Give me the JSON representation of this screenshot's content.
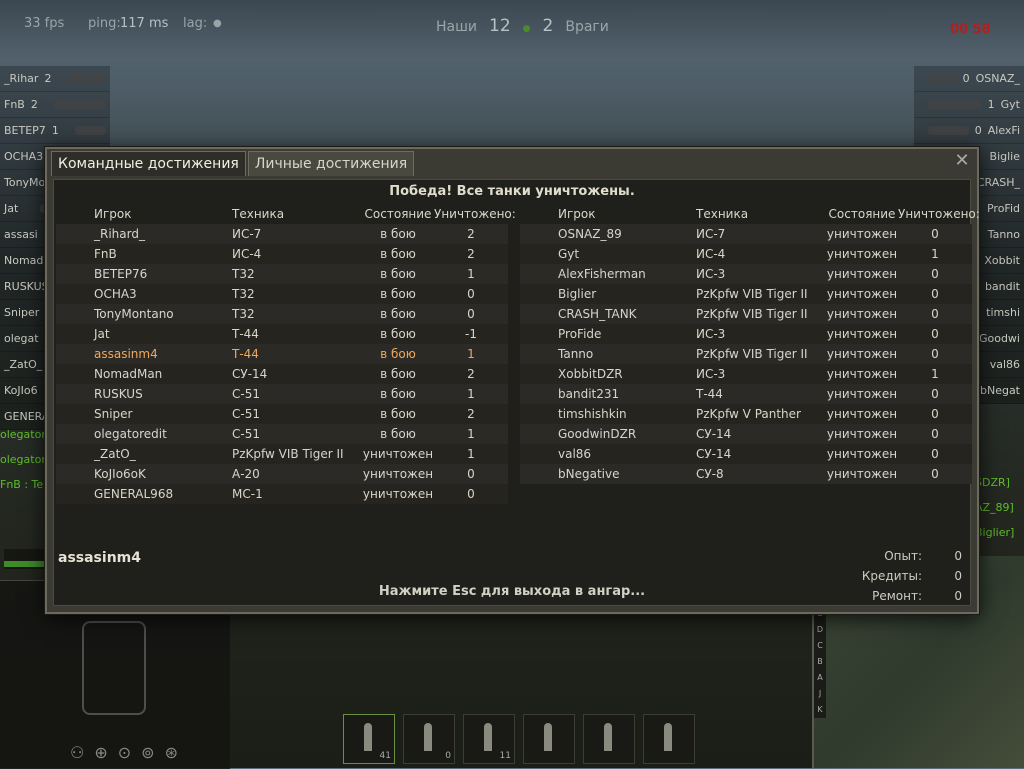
{
  "hud": {
    "fps": "33 fps",
    "ping_label": "ping:",
    "ping_value": "117 ms",
    "lag_label": "lag:",
    "allies_label": "Наши",
    "enemies_label": "Враги",
    "allies_score": "12",
    "enemies_score": "2",
    "timer": "00 58"
  },
  "side_left": [
    {
      "name": "_Rihar",
      "kills": "2"
    },
    {
      "name": "FnB",
      "kills": "2"
    },
    {
      "name": "BETEP7",
      "kills": "1"
    },
    {
      "name": "OCHA3",
      "kills": ""
    },
    {
      "name": "TonyMo",
      "kills": ""
    },
    {
      "name": "Jat",
      "kills": ""
    },
    {
      "name": "assasi",
      "kills": ""
    },
    {
      "name": "NomadM",
      "kills": ""
    },
    {
      "name": "RUSKUS",
      "kills": ""
    },
    {
      "name": "Sniper",
      "kills": ""
    },
    {
      "name": "olegat",
      "kills": ""
    },
    {
      "name": "_ZatO_",
      "kills": ""
    },
    {
      "name": "KoJIo6",
      "kills": ""
    },
    {
      "name": "GENERA",
      "kills": ""
    }
  ],
  "side_right": [
    {
      "name": "OSNAZ_",
      "kills": "0"
    },
    {
      "name": "Gyt",
      "kills": "1"
    },
    {
      "name": "AlexFi",
      "kills": "0"
    },
    {
      "name": "Biglie",
      "kills": ""
    },
    {
      "name": "CRASH_",
      "kills": ""
    },
    {
      "name": "ProFid",
      "kills": ""
    },
    {
      "name": "Tanno",
      "kills": ""
    },
    {
      "name": "Xobbit",
      "kills": ""
    },
    {
      "name": "bandit",
      "kills": ""
    },
    {
      "name": "timshi",
      "kills": ""
    },
    {
      "name": "Goodwi",
      "kills": ""
    },
    {
      "name": "val86",
      "kills": ""
    },
    {
      "name": "bNegat",
      "kills": ""
    }
  ],
  "chat": [
    "olegator",
    "olegator",
    "FnB : Te"
  ],
  "chat_right": [
    "SDZR]",
    "AZ_89]",
    "Biglier]"
  ],
  "minimap_letters": [
    "E",
    "D",
    "C",
    "B",
    "A",
    "J",
    "K"
  ],
  "ammo": [
    {
      "count": "41",
      "selected": true
    },
    {
      "count": "0",
      "selected": false
    },
    {
      "count": "11",
      "selected": false
    },
    {
      "count": "",
      "selected": false
    },
    {
      "count": "",
      "selected": false
    },
    {
      "count": "",
      "selected": false
    }
  ],
  "dialog": {
    "tabs": [
      {
        "label": "Командные достижения",
        "active": true
      },
      {
        "label": "Личные достижения",
        "active": false
      }
    ],
    "close": "✕",
    "result": "Победа! Все танки уничтожены.",
    "columns": {
      "player": "Игрок",
      "vehicle": "Техника",
      "state": "Состояние",
      "kills": "Уничтожено:"
    },
    "allies": [
      {
        "player": "_Rihard_",
        "vehicle": "ИС-7",
        "state": "в бою",
        "kills": "2"
      },
      {
        "player": "FnB",
        "vehicle": "ИС-4",
        "state": "в бою",
        "kills": "2"
      },
      {
        "player": "BETEP76",
        "vehicle": "T32",
        "state": "в бою",
        "kills": "1"
      },
      {
        "player": "OCHA3",
        "vehicle": "T32",
        "state": "в бою",
        "kills": "0"
      },
      {
        "player": "TonyMontano",
        "vehicle": "T32",
        "state": "в бою",
        "kills": "0"
      },
      {
        "player": "Jat",
        "vehicle": "Т-44",
        "state": "в бою",
        "kills": "-1"
      },
      {
        "player": "assasinm4",
        "vehicle": "Т-44",
        "state": "в бою",
        "kills": "1",
        "me": true
      },
      {
        "player": "NomadMan",
        "vehicle": "СУ-14",
        "state": "в бою",
        "kills": "2"
      },
      {
        "player": "RUSKUS",
        "vehicle": "С-51",
        "state": "в бою",
        "kills": "1"
      },
      {
        "player": "Sniper",
        "vehicle": "С-51",
        "state": "в бою",
        "kills": "2"
      },
      {
        "player": "olegatoredit",
        "vehicle": "С-51",
        "state": "в бою",
        "kills": "1"
      },
      {
        "player": "_ZatO_",
        "vehicle": "PzKpfw VIB Tiger II",
        "state": "уничтожен",
        "kills": "1"
      },
      {
        "player": "KoJIo6oK",
        "vehicle": "А-20",
        "state": "уничтожен",
        "kills": "0"
      },
      {
        "player": "GENERAL968",
        "vehicle": "МС-1",
        "state": "уничтожен",
        "kills": "0"
      }
    ],
    "enemies": [
      {
        "player": "OSNAZ_89",
        "vehicle": "ИС-7",
        "state": "уничтожен",
        "kills": "0"
      },
      {
        "player": "Gyt",
        "vehicle": "ИС-4",
        "state": "уничтожен",
        "kills": "1"
      },
      {
        "player": "AlexFisherman",
        "vehicle": "ИС-3",
        "state": "уничтожен",
        "kills": "0"
      },
      {
        "player": "Biglier",
        "vehicle": "PzKpfw VIB Tiger II",
        "state": "уничтожен",
        "kills": "0"
      },
      {
        "player": "CRASH_TANK",
        "vehicle": "PzKpfw VIB Tiger II",
        "state": "уничтожен",
        "kills": "0"
      },
      {
        "player": "ProFide",
        "vehicle": "ИС-3",
        "state": "уничтожен",
        "kills": "0"
      },
      {
        "player": "Tanno",
        "vehicle": "PzKpfw VIB Tiger II",
        "state": "уничтожен",
        "kills": "0"
      },
      {
        "player": "XobbitDZR",
        "vehicle": "ИС-3",
        "state": "уничтожен",
        "kills": "1"
      },
      {
        "player": "bandit231",
        "vehicle": "Т-44",
        "state": "уничтожен",
        "kills": "0"
      },
      {
        "player": "timshishkin",
        "vehicle": "PzKpfw V Panther",
        "state": "уничтожен",
        "kills": "0"
      },
      {
        "player": "GoodwinDZR",
        "vehicle": "СУ-14",
        "state": "уничтожен",
        "kills": "0"
      },
      {
        "player": "val86",
        "vehicle": "СУ-14",
        "state": "уничтожен",
        "kills": "0"
      },
      {
        "player": "bNegative",
        "vehicle": "СУ-8",
        "state": "уничтожен",
        "kills": "0"
      }
    ],
    "player_name": "assasinm4",
    "rewards": [
      {
        "label": "Опыт:",
        "value": "0"
      },
      {
        "label": "Кредиты:",
        "value": "0"
      },
      {
        "label": "Ремонт:",
        "value": "0"
      }
    ],
    "esc_hint": "Нажмите Esc для выхода в ангар..."
  }
}
